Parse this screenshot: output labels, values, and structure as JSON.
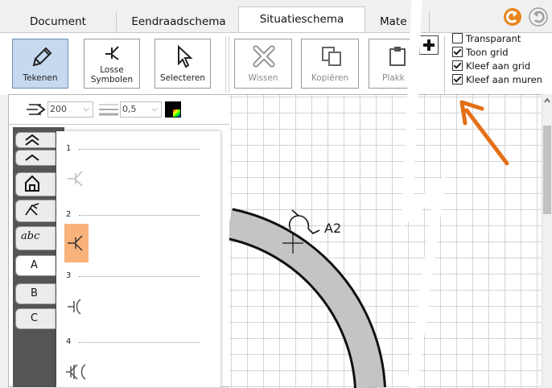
{
  "tabs": [
    {
      "label": "Document"
    },
    {
      "label": "Eendraadschema"
    },
    {
      "label": "Situatieschema"
    },
    {
      "label": "Mate"
    }
  ],
  "ribbon": {
    "tekenen": "Tekenen",
    "losse_l1": "Losse",
    "losse_l2": "Symbolen",
    "selecteren": "Selecteren",
    "wissen": "Wissen",
    "kopieren": "Kopiëren",
    "plakken": "Plakk"
  },
  "options": [
    {
      "label": "Transparant",
      "checked": false
    },
    {
      "label": "Toon grid",
      "checked": true
    },
    {
      "label": "Kleef aan grid",
      "checked": true
    },
    {
      "label": "Kleef aan muren",
      "checked": true
    }
  ],
  "toolbar": {
    "size": "200",
    "line": "0,5"
  },
  "side_tabs": [
    "A",
    "B",
    "C"
  ],
  "symbols": [
    "1",
    "2",
    "3",
    "4"
  ],
  "canvas": {
    "label": "A2"
  },
  "colors": {
    "accent": "#e46f16",
    "selected_symbol": "#f9b27a",
    "ribbon_selected": "#c7d9ee"
  }
}
